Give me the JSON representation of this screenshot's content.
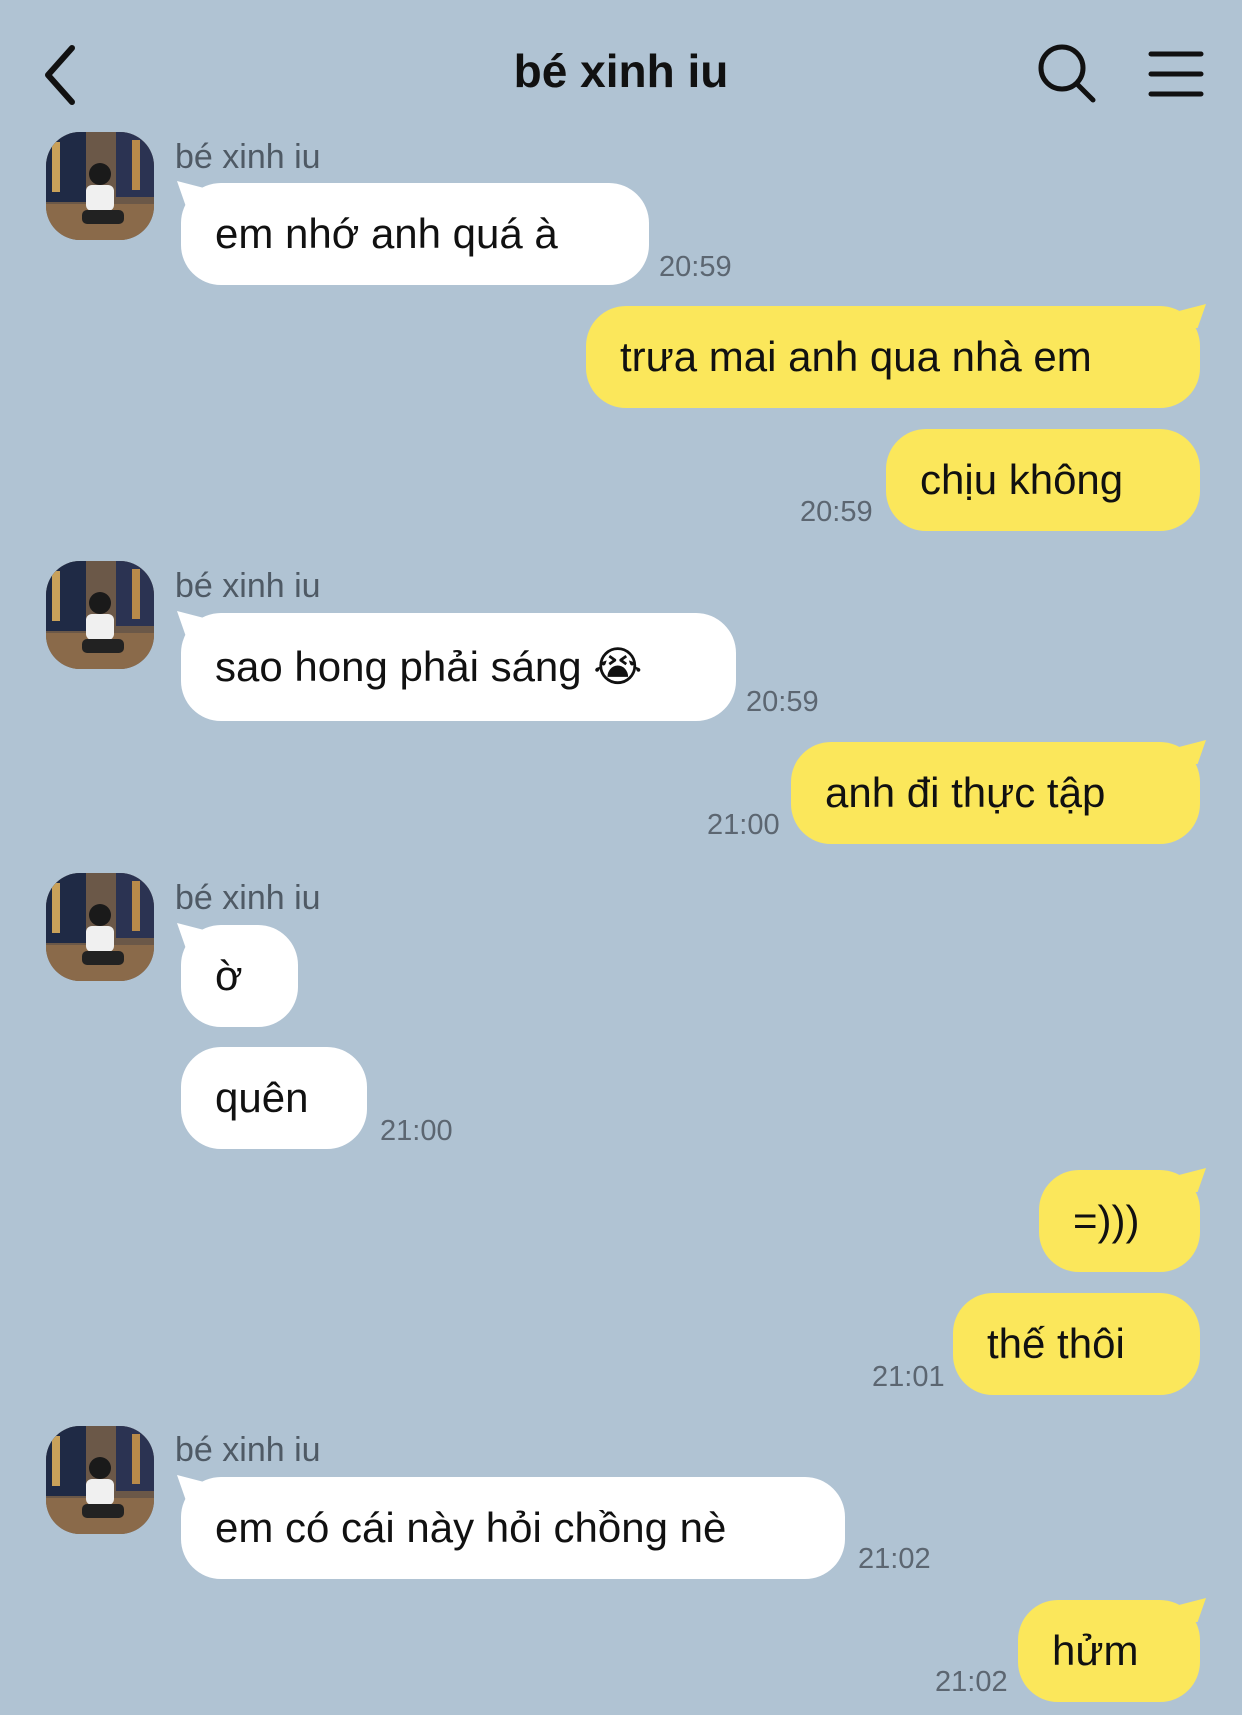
{
  "header": {
    "title": "bé xinh iu"
  },
  "contact": {
    "name": "bé xinh iu"
  },
  "messages": [
    {
      "from": "contact",
      "text": "em nhớ anh quá à",
      "time": "20:59"
    },
    {
      "from": "me",
      "text": "trưa mai anh qua nhà em"
    },
    {
      "from": "me",
      "text": "chịu không",
      "time": "20:59"
    },
    {
      "from": "contact",
      "text": "sao hong phải sáng 😭",
      "time": "20:59"
    },
    {
      "from": "me",
      "text": "anh đi thực tập",
      "time": "21:00"
    },
    {
      "from": "contact",
      "text": "ờ"
    },
    {
      "from": "contact",
      "text": "quên",
      "time": "21:00"
    },
    {
      "from": "me",
      "text": "=)))"
    },
    {
      "from": "me",
      "text": "thế thôi",
      "time": "21:01"
    },
    {
      "from": "contact",
      "text": "em có cái này hỏi chồng nè",
      "time": "21:02"
    },
    {
      "from": "me",
      "text": "hửm",
      "time": "21:02"
    }
  ]
}
